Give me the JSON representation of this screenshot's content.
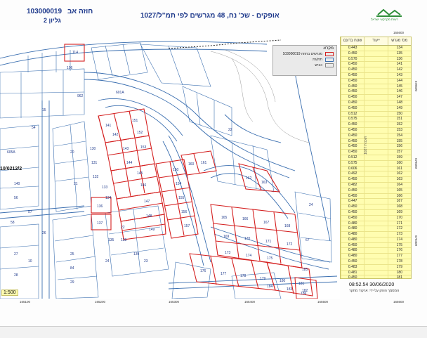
{
  "header": {
    "contract_label": "חוזה אב",
    "contract_number": "103000019",
    "sheet_label": "גליון 2",
    "title": "אופקים - שכ' נח, 48 מגרשים לפי תמ\"ל/1027",
    "logo_text": "רשות מקרקעי ישראל"
  },
  "legend": {
    "title": "מקרא",
    "items": [
      {
        "label": "103000019 מגרשים בחוזה",
        "color": "#d42020"
      },
      {
        "label": "תת/גת",
        "color": "#3b6fb0"
      },
      {
        "label": "כביש",
        "color": "#888888"
      }
    ]
  },
  "table": {
    "headers": [
      "מס' מגרש",
      "ייעוד",
      "שטח בדונם"
    ],
    "rows": [
      [
        "134",
        "",
        "0.443"
      ],
      [
        "135",
        "",
        "0.450"
      ],
      [
        "136",
        "",
        "0.570"
      ],
      [
        "141",
        "",
        "0.450"
      ],
      [
        "142",
        "",
        "0.450"
      ],
      [
        "143",
        "",
        "0.450"
      ],
      [
        "144",
        "",
        "0.450"
      ],
      [
        "145",
        "",
        "0.450"
      ],
      [
        "146",
        "",
        "0.450"
      ],
      [
        "147",
        "",
        "0.450"
      ],
      [
        "148",
        "",
        "0.450"
      ],
      [
        "149",
        "",
        "0.450"
      ],
      [
        "150",
        "",
        "0.512"
      ],
      [
        "151",
        "",
        "0.575"
      ],
      [
        "152",
        "",
        "0.450"
      ],
      [
        "153",
        "",
        "0.450"
      ],
      [
        "154",
        "",
        "0.450"
      ],
      [
        "155",
        "",
        "0.450"
      ],
      [
        "156",
        "",
        "0.450"
      ],
      [
        "157",
        "",
        "0.450"
      ],
      [
        "159",
        "",
        "0.512"
      ],
      [
        "160",
        "",
        "0.575"
      ],
      [
        "161",
        "",
        "0.606"
      ],
      [
        "162",
        "",
        "0.492"
      ],
      [
        "163",
        "",
        "0.450"
      ],
      [
        "164",
        "",
        "0.482"
      ],
      [
        "165",
        "",
        "0.450"
      ],
      [
        "166",
        "",
        "0.450"
      ],
      [
        "167",
        "",
        "0.447"
      ],
      [
        "168",
        "",
        "0.450"
      ],
      [
        "169",
        "",
        "0.450"
      ],
      [
        "170",
        "",
        "0.450"
      ],
      [
        "171",
        "",
        "0.480"
      ],
      [
        "172",
        "",
        "0.480"
      ],
      [
        "173",
        "",
        "0.480"
      ],
      [
        "174",
        "",
        "0.480"
      ],
      [
        "175",
        "",
        "0.450"
      ],
      [
        "176",
        "",
        "0.480"
      ],
      [
        "177",
        "",
        "0.480"
      ],
      [
        "178",
        "",
        "0.450"
      ],
      [
        "179",
        "",
        "0.483"
      ],
      [
        "180",
        "",
        "0.481"
      ],
      [
        "181",
        "",
        "0.450"
      ],
      [
        "182",
        "",
        "0.450"
      ],
      [
        "183",
        "",
        "0.591"
      ],
      [
        "184",
        "",
        "0.452"
      ],
      [
        "185",
        "",
        "0.477"
      ],
      [
        "186",
        "",
        "0.450"
      ]
    ]
  },
  "table_side_label": "תוכנית 1027",
  "scale_label": "1:500",
  "plan_number_left": "10/0212/2",
  "timestamp": "08:52.54 30/06/2020",
  "printed_by": "המסמך הופק על-ידי: ארקוד מחקר",
  "grid_coords_x": [
    "165100",
    "165200",
    "165300",
    "165400",
    "165500",
    "165600"
  ],
  "grid_coords_y": [
    "578600",
    "578500",
    "578400"
  ],
  "parcels": {
    "red": [
      "114",
      "141",
      "142",
      "143",
      "144",
      "145",
      "146",
      "147",
      "148",
      "149",
      "150",
      "151",
      "152",
      "153",
      "154",
      "155",
      "156",
      "157",
      "136",
      "137",
      "160",
      "161",
      "162",
      "163",
      "165",
      "166",
      "167",
      "168",
      "169",
      "170",
      "171",
      "172",
      "173",
      "174",
      "175",
      "176",
      "177",
      "178",
      "179",
      "180",
      "181",
      "182",
      "183",
      "184",
      "185",
      "186"
    ],
    "blue": [
      "106",
      "962",
      "601A",
      "605A",
      "20",
      "21",
      "22",
      "23",
      "24",
      "25",
      "26",
      "27",
      "28",
      "29",
      "130",
      "131",
      "132",
      "133",
      "134",
      "135",
      "138",
      "139",
      "140",
      "56",
      "57",
      "58",
      "54",
      "15",
      "10",
      "22",
      "24",
      "67",
      "84",
      "93",
      "964"
    ]
  }
}
